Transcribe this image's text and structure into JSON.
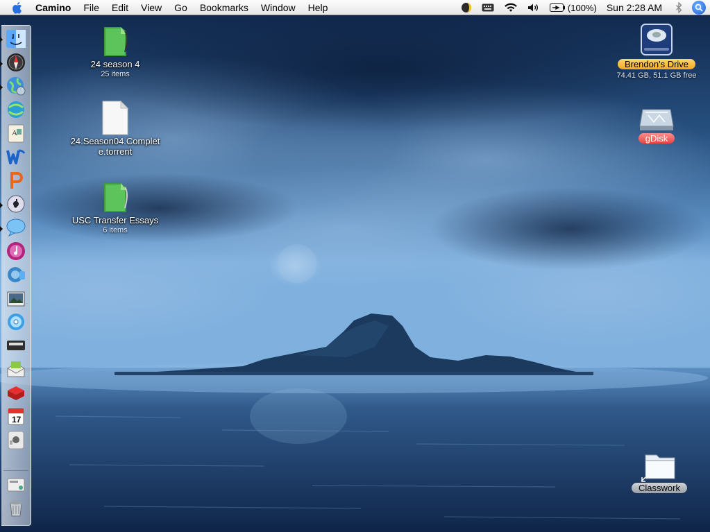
{
  "menubar": {
    "app_name": "Camino",
    "menus": [
      "File",
      "Edit",
      "View",
      "Go",
      "Bookmarks",
      "Window",
      "Help"
    ],
    "battery_percent": "(100%)",
    "clock": "Sun 2:28 AM"
  },
  "desktop": {
    "left_icons": [
      {
        "name": "24 season 4",
        "sub": "25 items",
        "icon": "green-folder-icon"
      },
      {
        "name": "24.Season04.Complete.torrent",
        "name_line1": "24.Season04.Complet",
        "name_line2": "e.torrent",
        "icon": "document-icon"
      },
      {
        "name": "USC Transfer Essays",
        "sub": "6 items",
        "icon": "green-folder-icon"
      }
    ],
    "right_icons": [
      {
        "name": "Brendon's Drive",
        "sub": "74.41 GB, 51.1 GB free",
        "icon": "hard-drive-icon",
        "label_color": "#f5b536"
      },
      {
        "name": "gDisk",
        "icon": "network-disk-icon",
        "label_color": "#e84848"
      },
      {
        "name": "Classwork",
        "icon": "folder-alias-icon",
        "label_color": "#a9aeb5"
      }
    ]
  },
  "dock": {
    "items": [
      {
        "icon": "finder-icon",
        "running": true
      },
      {
        "icon": "safari-compass-icon",
        "running": true
      },
      {
        "icon": "network-globe-icon",
        "running": true
      },
      {
        "icon": "camino-browser-icon",
        "running": false
      },
      {
        "icon": "dictionary-icon",
        "running": false
      },
      {
        "icon": "word-icon",
        "running": false
      },
      {
        "icon": "powerpoint-icon",
        "running": false
      },
      {
        "icon": "itunes-icon",
        "running": true
      },
      {
        "icon": "ichat-icon",
        "running": true
      },
      {
        "icon": "itunes-music-icon",
        "running": false
      },
      {
        "icon": "garageband-icon",
        "running": false
      },
      {
        "icon": "iphoto-icon",
        "running": false
      },
      {
        "icon": "dvd-player-icon",
        "running": false
      },
      {
        "icon": "card-reader-icon",
        "running": false
      },
      {
        "icon": "mail-stamp-icon",
        "running": false
      },
      {
        "icon": "red-app-icon",
        "running": false
      },
      {
        "icon": "ical-icon",
        "running": false,
        "text": "17"
      },
      {
        "icon": "system-preferences-icon",
        "running": false
      },
      {
        "icon": "downloads-stack-icon",
        "running": false
      },
      {
        "icon": "trash-icon",
        "running": false
      }
    ]
  }
}
